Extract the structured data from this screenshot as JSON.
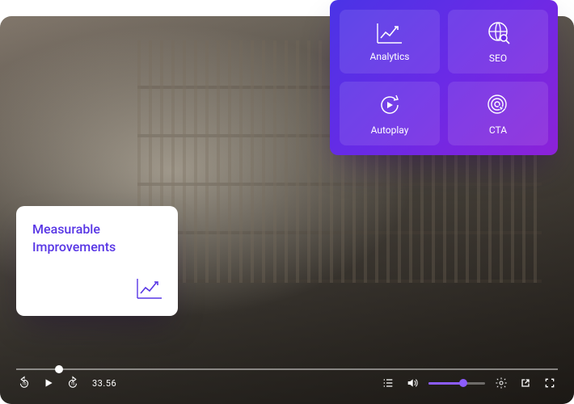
{
  "card": {
    "title_line1": "Measurable",
    "title_line2": "Improvements"
  },
  "features": {
    "analytics": "Analytics",
    "seo": "SEO",
    "autoplay": "Autoplay",
    "cta": "CTA"
  },
  "player": {
    "time": "33.56"
  }
}
